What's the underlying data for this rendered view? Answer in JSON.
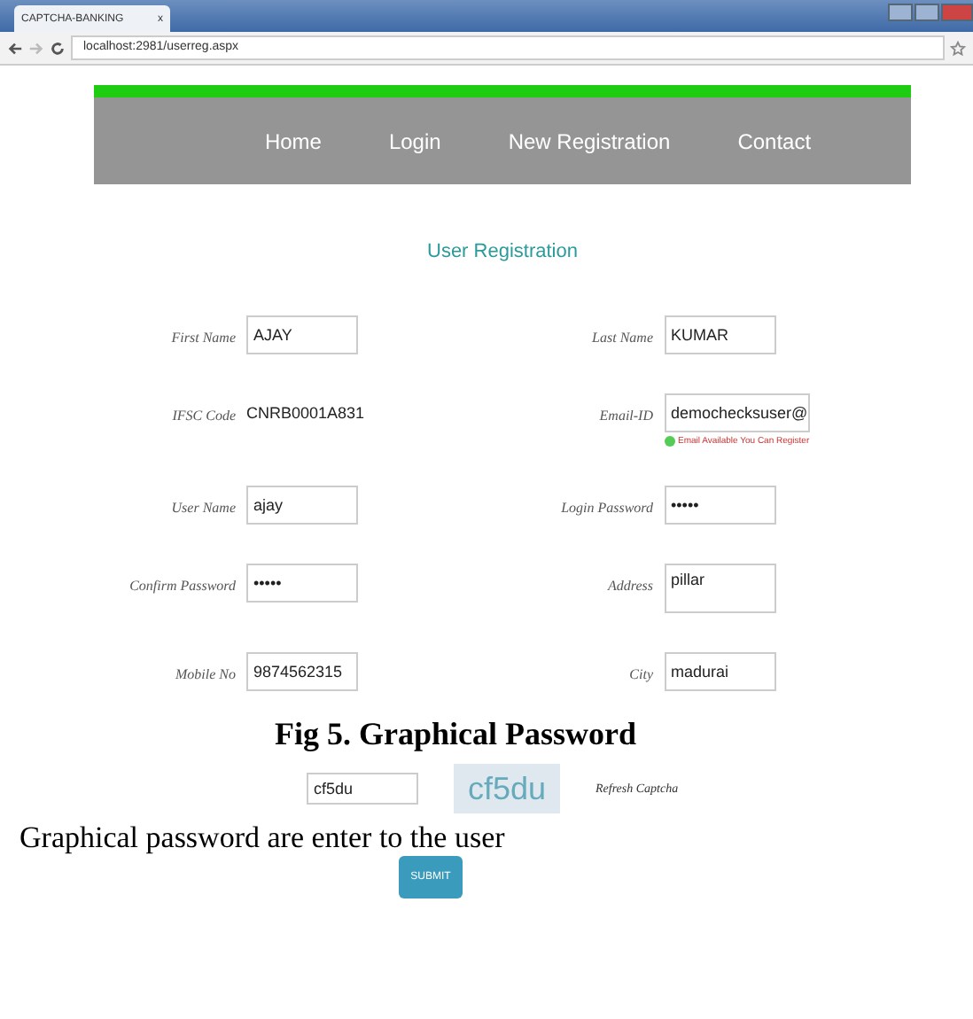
{
  "browser": {
    "tab_title": "CAPTCHA-BANKING",
    "tab_close": "x",
    "url": "localhost:2981/userreg.aspx"
  },
  "nav": [
    {
      "label": "Home"
    },
    {
      "label": "Login"
    },
    {
      "label": "New Registration"
    },
    {
      "label": "Contact"
    }
  ],
  "heading": "User Registration",
  "fields": [
    {
      "label": "First Name",
      "value": "AJAY",
      "kind": "input"
    },
    {
      "label": "Last Name",
      "value": "KUMAR",
      "kind": "input"
    },
    {
      "label": "IFSC Code",
      "value": "CNRB0001A831",
      "kind": "text"
    },
    {
      "label": "Email-ID",
      "value": "demochecksuser@",
      "kind": "input",
      "note": "Email Available You Can Register"
    },
    {
      "label": "User Name",
      "value": "ajay",
      "kind": "input"
    },
    {
      "label": "Login Password",
      "value": "•••••",
      "kind": "input"
    },
    {
      "label": "Confirm Password",
      "value": "•••••",
      "kind": "input"
    },
    {
      "label": "Address",
      "value": "pillar",
      "kind": "textarea"
    },
    {
      "label": "Mobile No",
      "value": "9874562315",
      "kind": "input"
    },
    {
      "label": "City",
      "value": "madurai",
      "kind": "input"
    }
  ],
  "caption": "Fig 5. Graphical Password",
  "captcha": {
    "value": "cf5du",
    "image_text": "cf5du",
    "refresh": "Refresh Captcha"
  },
  "paragraph": "Graphical password are enter to the user",
  "submit": "SUBMIT"
}
